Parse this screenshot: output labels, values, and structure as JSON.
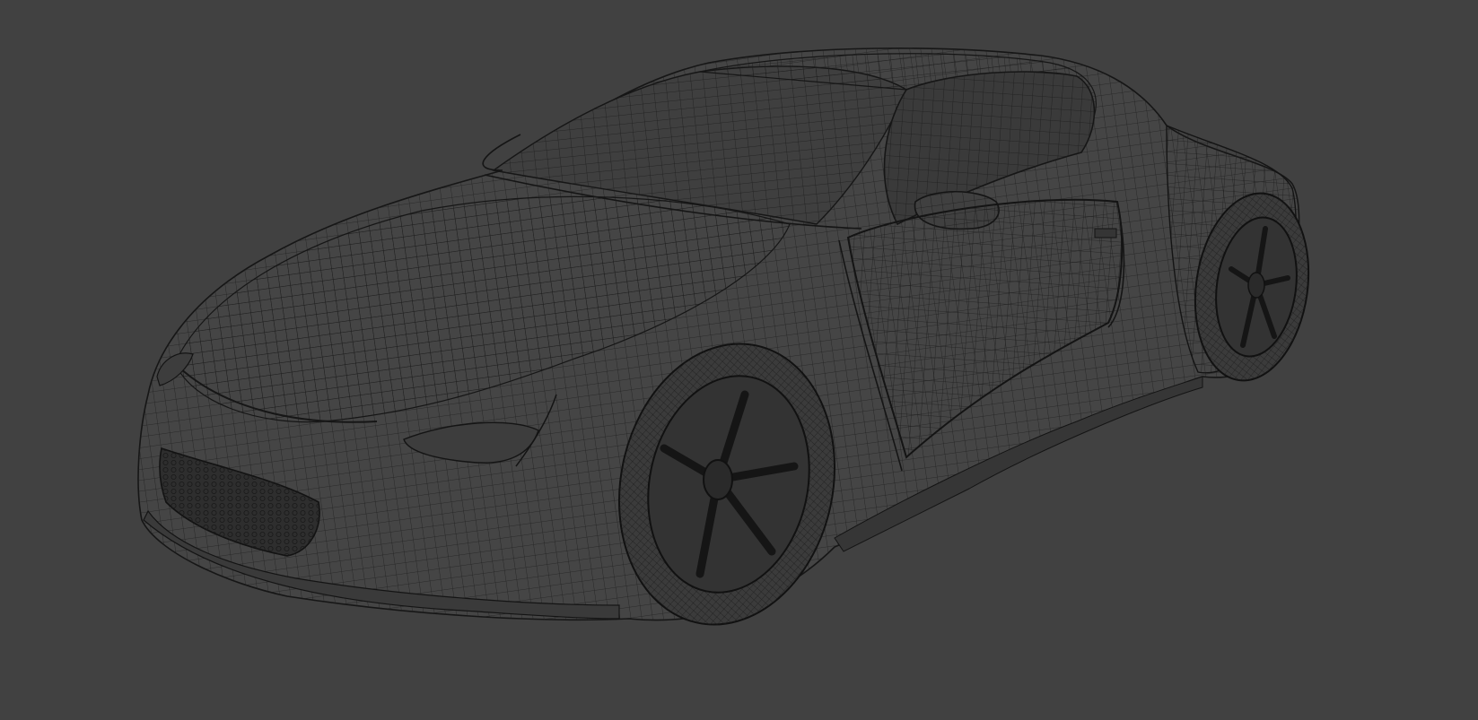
{
  "scene": {
    "subject": "car-wireframe-mesh",
    "colors": {
      "background": "#414141",
      "body_fill": "#454545",
      "wire": "#1a1a1a",
      "wire_light": "#2a2a2a",
      "tire": "#3b3b3b",
      "rim": "#353535",
      "grille": "#2e2e2e"
    }
  }
}
